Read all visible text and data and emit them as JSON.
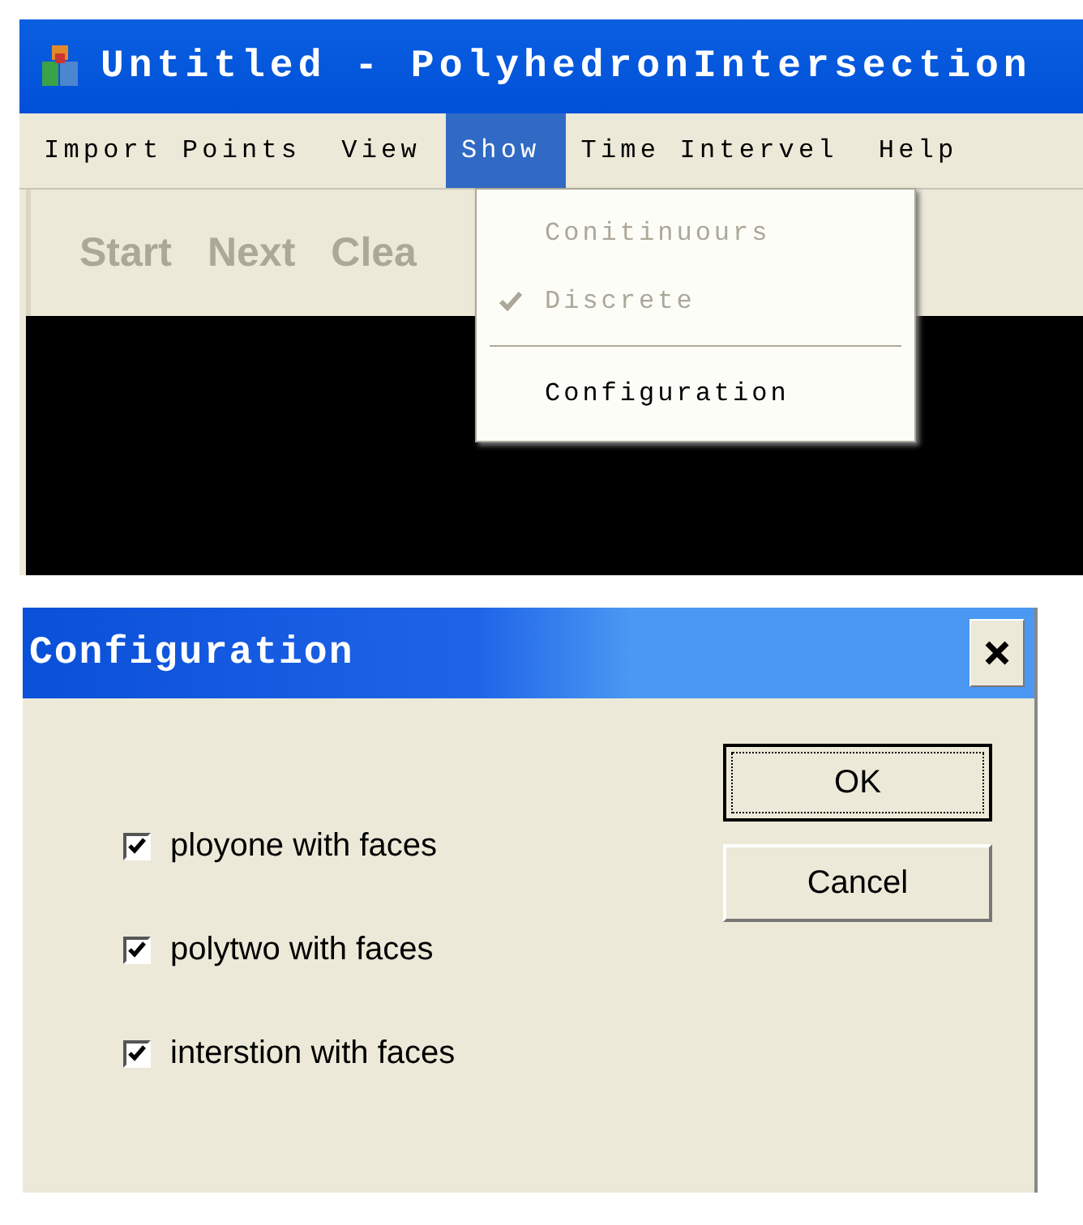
{
  "main_window": {
    "title": "Untitled - PolyhedronIntersection",
    "menu": [
      {
        "label": "Import Points",
        "selected": false
      },
      {
        "label": "View",
        "selected": false
      },
      {
        "label": "Show",
        "selected": true
      },
      {
        "label": "Time Intervel",
        "selected": false
      },
      {
        "label": "Help",
        "selected": false
      }
    ],
    "toolbar": [
      {
        "label": "Start",
        "disabled": true
      },
      {
        "label": "Next",
        "disabled": true
      },
      {
        "label": "Clea",
        "disabled": true
      }
    ],
    "dropdown": [
      {
        "kind": "item",
        "label": "Conitinuours",
        "disabled": true,
        "checked": false
      },
      {
        "kind": "item",
        "label": "Discrete",
        "disabled": true,
        "checked": true
      },
      {
        "kind": "separator"
      },
      {
        "kind": "item",
        "label": "Configuration",
        "disabled": false,
        "checked": false
      }
    ]
  },
  "dialog": {
    "title": "Configuration",
    "options": [
      {
        "label": "ployone with faces",
        "checked": true
      },
      {
        "label": "polytwo with faces",
        "checked": true
      },
      {
        "label": "interstion with faces",
        "checked": true
      }
    ],
    "buttons": [
      {
        "label": "OK",
        "default": true
      },
      {
        "label": "Cancel",
        "default": false
      }
    ]
  }
}
